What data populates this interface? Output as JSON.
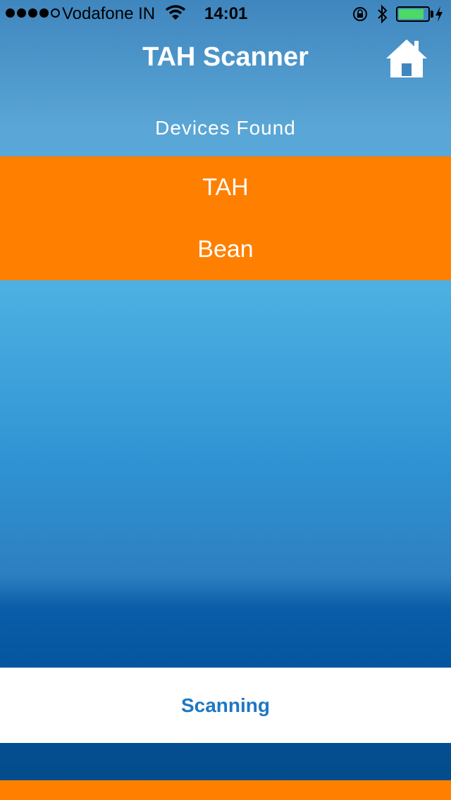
{
  "status_bar": {
    "signal_bars": 4,
    "signal_max": 5,
    "carrier": "Vodafone IN",
    "time": "14:01",
    "battery_level": 0.88,
    "battery_color": "#4cd964"
  },
  "header": {
    "title": "TAH Scanner",
    "home_icon": "home-icon"
  },
  "devices": {
    "section_label": "Devices Found",
    "items": [
      {
        "label": "TAH"
      },
      {
        "label": "Bean"
      }
    ]
  },
  "scan_button": {
    "label": "Scanning"
  },
  "colors": {
    "accent": "#ff8000",
    "button_text": "#1f77c2",
    "background_top": "#3f86be",
    "background_bottom": "#044a86"
  }
}
